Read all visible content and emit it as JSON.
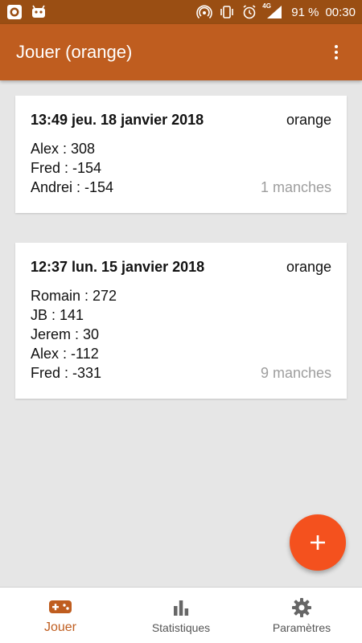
{
  "colors": {
    "status_bar": "#9a4e13",
    "app_bar": "#bf5d1f",
    "accent": "#f4511e",
    "background": "#e6e6e6",
    "muted_text": "#9e9e9e"
  },
  "status_bar": {
    "battery": "91 %",
    "time": "00:30",
    "network": "4G",
    "icons": [
      "app-record-icon",
      "android-icon",
      "hotspot-icon",
      "vibrate-icon",
      "alarm-icon",
      "signal-icon"
    ]
  },
  "app_bar": {
    "title": "Jouer (orange)",
    "menu_icon": "more-vert-icon"
  },
  "games": [
    {
      "date": "13:49 jeu. 18 janvier 2018",
      "deck": "orange",
      "players": [
        "Alex  :  308",
        "Fred  :  -154",
        "Andrei   :  -154"
      ],
      "rounds": "1 manches"
    },
    {
      "date": "12:37 lun. 15 janvier 2018",
      "deck": "orange",
      "players": [
        "Romain  :  272",
        "JB  :  141",
        "Jerem   :  30",
        "Alex  :  -112",
        "Fred  :  -331"
      ],
      "rounds": "9 manches"
    }
  ],
  "fab": {
    "icon": "plus-icon"
  },
  "bottom_nav": {
    "items": [
      {
        "label": "Jouer",
        "icon": "gamepad-icon",
        "active": true
      },
      {
        "label": "Statistiques",
        "icon": "bar-chart-icon",
        "active": false
      },
      {
        "label": "Paramètres",
        "icon": "gear-icon",
        "active": false
      }
    ]
  }
}
